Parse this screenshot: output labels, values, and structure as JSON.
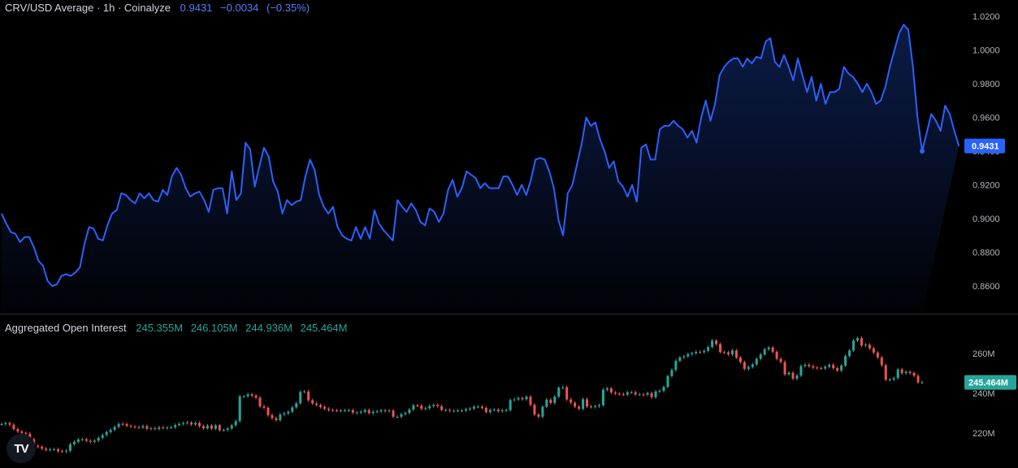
{
  "header": {
    "title": "CRV/USD Average · 1h · Coinalyze",
    "last": "0.9431",
    "change": "−0.0034",
    "change_pct": "(−0.35%)"
  },
  "oi_header": {
    "title": "Aggregated Open Interest",
    "o": "245.355M",
    "h": "246.105M",
    "l": "244.936M",
    "c": "245.464M"
  },
  "colors": {
    "line": "#2962ff",
    "up": "#26a69a",
    "down": "#ef5350",
    "background": "#000000"
  },
  "logo": {
    "text": "TV",
    "icon": "tradingview-logo-icon"
  },
  "chart_data": [
    {
      "type": "area",
      "title": "CRV/USD Average · 1h · Coinalyze",
      "ylim": [
        0.85,
        1.025
      ],
      "yticks": [
        "1.0200",
        "1.0000",
        "0.9800",
        "0.9600",
        "0.9400",
        "0.9200",
        "0.9000",
        "0.8800",
        "0.8600"
      ],
      "last_value_label": "0.9431",
      "x": [
        0,
        1,
        2,
        3,
        4,
        5,
        6,
        7,
        8,
        9,
        10,
        11,
        12,
        13,
        14,
        15,
        16,
        17,
        18,
        19,
        20,
        21,
        22,
        23,
        24,
        25,
        26,
        27,
        28,
        29,
        30,
        31,
        32,
        33,
        34,
        35,
        36,
        37,
        38,
        39,
        40,
        41,
        42,
        43,
        44,
        45,
        46,
        47,
        48,
        49,
        50,
        51,
        52,
        53,
        54,
        55,
        56,
        57,
        58,
        59,
        60,
        61,
        62,
        63,
        64,
        65,
        66,
        67,
        68,
        69,
        70,
        71,
        72,
        73,
        74,
        75,
        76,
        77,
        78,
        79,
        80,
        81,
        82,
        83,
        84,
        85,
        86,
        87,
        88,
        89,
        90,
        91,
        92,
        93,
        94,
        95,
        96,
        97,
        98,
        99,
        100,
        101,
        102,
        103,
        104,
        105,
        106,
        107,
        108,
        109,
        110,
        111,
        112,
        113,
        114,
        115,
        116,
        117,
        118,
        119,
        120,
        121,
        122,
        123,
        124,
        125,
        126,
        127,
        128,
        129,
        130,
        131,
        132,
        133,
        134,
        135,
        136,
        137,
        138,
        139,
        140,
        141,
        142,
        143,
        144,
        145,
        146,
        147,
        148,
        149,
        150,
        151,
        152,
        153,
        154,
        155,
        156,
        157,
        158,
        159,
        160,
        161,
        162,
        163,
        164,
        165,
        166,
        167,
        168,
        169,
        170,
        171,
        172,
        173,
        174,
        175,
        176,
        177,
        178,
        179,
        180,
        181,
        182,
        183,
        184,
        185,
        186,
        187,
        188,
        189,
        190,
        191,
        192,
        193,
        194,
        195,
        196,
        197,
        198,
        199,
        200
      ],
      "series": [
        {
          "values": [
            0.903,
            0.897,
            0.892,
            0.891,
            0.886,
            0.889,
            0.889,
            0.883,
            0.875,
            0.872,
            0.863,
            0.86,
            0.861,
            0.866,
            0.867,
            0.866,
            0.868,
            0.871,
            0.885,
            0.895,
            0.894,
            0.888,
            0.887,
            0.896,
            0.903,
            0.905,
            0.915,
            0.914,
            0.911,
            0.909,
            0.915,
            0.912,
            0.915,
            0.911,
            0.91,
            0.917,
            0.914,
            0.925,
            0.93,
            0.926,
            0.918,
            0.913,
            0.915,
            0.916,
            0.911,
            0.904,
            0.917,
            0.918,
            0.918,
            0.903,
            0.928,
            0.911,
            0.915,
            0.945,
            0.941,
            0.919,
            0.931,
            0.942,
            0.937,
            0.922,
            0.916,
            0.903,
            0.911,
            0.908,
            0.91,
            0.911,
            0.925,
            0.935,
            0.929,
            0.914,
            0.907,
            0.903,
            0.907,
            0.895,
            0.89,
            0.888,
            0.887,
            0.895,
            0.888,
            0.895,
            0.888,
            0.905,
            0.897,
            0.893,
            0.89,
            0.887,
            0.911,
            0.907,
            0.904,
            0.909,
            0.905,
            0.898,
            0.896,
            0.906,
            0.904,
            0.898,
            0.903,
            0.917,
            0.923,
            0.913,
            0.918,
            0.928,
            0.926,
            0.924,
            0.918,
            0.921,
            0.918,
            0.918,
            0.918,
            0.925,
            0.925,
            0.92,
            0.914,
            0.92,
            0.914,
            0.923,
            0.935,
            0.936,
            0.935,
            0.928,
            0.918,
            0.899,
            0.89,
            0.915,
            0.92,
            0.932,
            0.944,
            0.96,
            0.955,
            0.957,
            0.947,
            0.94,
            0.93,
            0.934,
            0.922,
            0.919,
            0.913,
            0.92,
            0.91,
            0.942,
            0.944,
            0.935,
            0.935,
            0.953,
            0.955,
            0.955,
            0.958,
            0.955,
            0.953,
            0.948,
            0.952,
            0.945,
            0.96,
            0.97,
            0.958,
            0.968,
            0.985,
            0.99,
            0.993,
            0.995,
            0.995,
            0.99,
            0.995,
            0.992,
            0.996,
            0.995,
            1.005,
            1.007,
            0.993,
            0.99,
            0.997,
            0.99,
            0.982,
            0.995,
            0.985,
            0.975,
            0.984,
            0.97,
            0.98,
            0.968,
            0.975,
            0.975,
            0.977,
            0.99,
            0.986,
            0.984,
            0.98,
            0.975,
            0.98,
            0.975,
            0.968,
            0.97,
            0.978,
            0.99,
            1.0,
            1.01,
            1.015,
            1.012,
            0.99,
            0.96,
            0.94,
            0.951,
            0.962,
            0.958,
            0.952,
            0.967,
            0.962,
            0.952,
            0.943
          ]
        }
      ]
    },
    {
      "type": "candlestick",
      "title": "Aggregated Open Interest",
      "ylim": [
        210,
        275
      ],
      "yticks": [
        "260M",
        "240M",
        "220M"
      ],
      "last_value_label": "245.464M",
      "x": [
        0,
        1,
        2,
        3,
        4,
        5,
        6,
        7,
        8,
        9,
        10,
        11,
        12,
        13,
        14,
        15,
        16,
        17,
        18,
        19,
        20,
        21,
        22,
        23,
        24,
        25,
        26,
        27,
        28,
        29,
        30,
        31,
        32,
        33,
        34,
        35,
        36,
        37,
        38,
        39,
        40,
        41,
        42,
        43,
        44,
        45,
        46,
        47,
        48,
        49,
        50,
        51,
        52,
        53,
        54,
        55,
        56,
        57,
        58,
        59,
        60,
        61,
        62,
        63,
        64,
        65,
        66,
        67,
        68,
        69,
        70,
        71,
        72,
        73,
        74,
        75,
        76,
        77,
        78,
        79,
        80,
        81,
        82,
        83,
        84,
        85,
        86,
        87,
        88,
        89,
        90,
        91,
        92,
        93,
        94,
        95,
        96,
        97,
        98,
        99,
        100,
        101,
        102,
        103,
        104,
        105,
        106,
        107,
        108,
        109,
        110,
        111,
        112,
        113,
        114,
        115,
        116,
        117,
        118,
        119,
        120,
        121,
        122,
        123,
        124,
        125,
        126,
        127,
        128,
        129,
        130,
        131,
        132,
        133,
        134,
        135,
        136,
        137,
        138,
        139,
        140,
        141,
        142,
        143,
        144,
        145,
        146,
        147,
        148,
        149,
        150,
        151,
        152,
        153,
        154,
        155,
        156,
        157,
        158,
        159,
        160,
        161,
        162,
        163,
        164,
        165,
        166,
        167,
        168,
        169,
        170,
        171,
        172,
        173,
        174,
        175,
        176,
        177,
        178,
        179,
        180,
        181,
        182,
        183,
        184,
        185,
        186,
        187,
        188,
        189,
        190,
        191,
        192,
        193,
        194,
        195,
        196,
        197,
        198,
        199,
        200
      ],
      "series": [
        {
          "name": "close",
          "values": [
            224.5,
            225.0,
            224.2,
            222.0,
            220.8,
            220.1,
            219.7,
            216.9,
            213.6,
            213.1,
            212.2,
            211.5,
            211.8,
            211.9,
            210.9,
            210.7,
            211.1,
            214.4,
            215.6,
            216.8,
            216.9,
            216.1,
            215.6,
            216.2,
            217.6,
            219.0,
            220.5,
            221.6,
            223.1,
            224.6,
            224.5,
            223.6,
            223.2,
            223.0,
            222.8,
            223.5,
            222.2,
            222.4,
            222.1,
            222.9,
            222.6,
            222.7,
            222.9,
            224.0,
            224.6,
            225.0,
            225.3,
            224.3,
            225.1,
            223.5,
            222.4,
            223.8,
            222.2,
            223.9,
            221.4,
            221.6,
            222.3,
            223.9,
            226.0,
            238.4,
            238.5,
            239.5,
            238.8,
            237.8,
            233.4,
            232.7,
            229.0,
            227.5,
            226.5,
            229.3,
            229.9,
            230.7,
            232.9,
            235.0,
            240.7,
            240.9,
            236.5,
            234.9,
            234.1,
            233.1,
            232.2,
            231.6,
            231.4,
            231.3,
            231.3,
            231.4,
            231.5,
            230.3,
            230.3,
            230.7,
            231.6,
            230.0,
            230.7,
            230.9,
            231.4,
            231.1,
            231.3,
            228.2,
            228.2,
            229.5,
            230.1,
            231.8,
            233.9,
            233.8,
            232.2,
            232.5,
            233.5,
            234.1,
            233.5,
            231.6,
            231.6,
            231.2,
            231.2,
            231.3,
            231.3,
            232.0,
            232.3,
            233.2,
            233.3,
            232.6,
            230.5,
            231.6,
            231.8,
            231.0,
            231.4,
            231.5,
            236.6,
            236.9,
            237.6,
            237.0,
            238.3,
            234.2,
            229.3,
            228.2,
            233.2,
            236.8,
            235.1,
            238.3,
            242.8,
            243.0,
            236.9,
            235.2,
            233.3,
            232.2,
            237.0,
            233.4,
            233.1,
            233.5,
            234.0,
            241.8,
            242.4,
            240.4,
            239.8,
            239.6,
            239.3,
            240.5,
            240.5,
            239.4,
            239.4,
            239.3,
            240.1,
            238.0,
            240.9,
            241.2,
            243.2,
            248.6,
            251.7,
            256.3,
            258.0,
            258.5,
            259.6,
            260.1,
            260.8,
            260.6,
            261.3,
            263.2,
            266.5,
            264.7,
            260.7,
            260.5,
            259.5,
            261.5,
            257.9,
            255.6,
            252.2,
            253.2,
            254.5,
            257.3,
            259.5,
            262.1,
            263.0,
            260.8,
            257.3,
            255.7,
            249.5,
            250.3,
            247.3,
            248.9,
            253.7,
            254.3,
            253.6,
            252.9,
            252.7,
            252.4,
            253.3,
            254.3,
            252.6,
            251.4,
            253.9,
            258.7,
            261.5,
            266.5,
            267.7,
            264.0,
            264.4,
            262.6,
            260.4,
            258.0,
            254.1,
            246.8,
            246.9,
            247.6,
            252.0,
            250.1,
            250.8,
            250.2,
            248.8,
            245.5,
            245.5
          ]
        }
      ]
    }
  ]
}
